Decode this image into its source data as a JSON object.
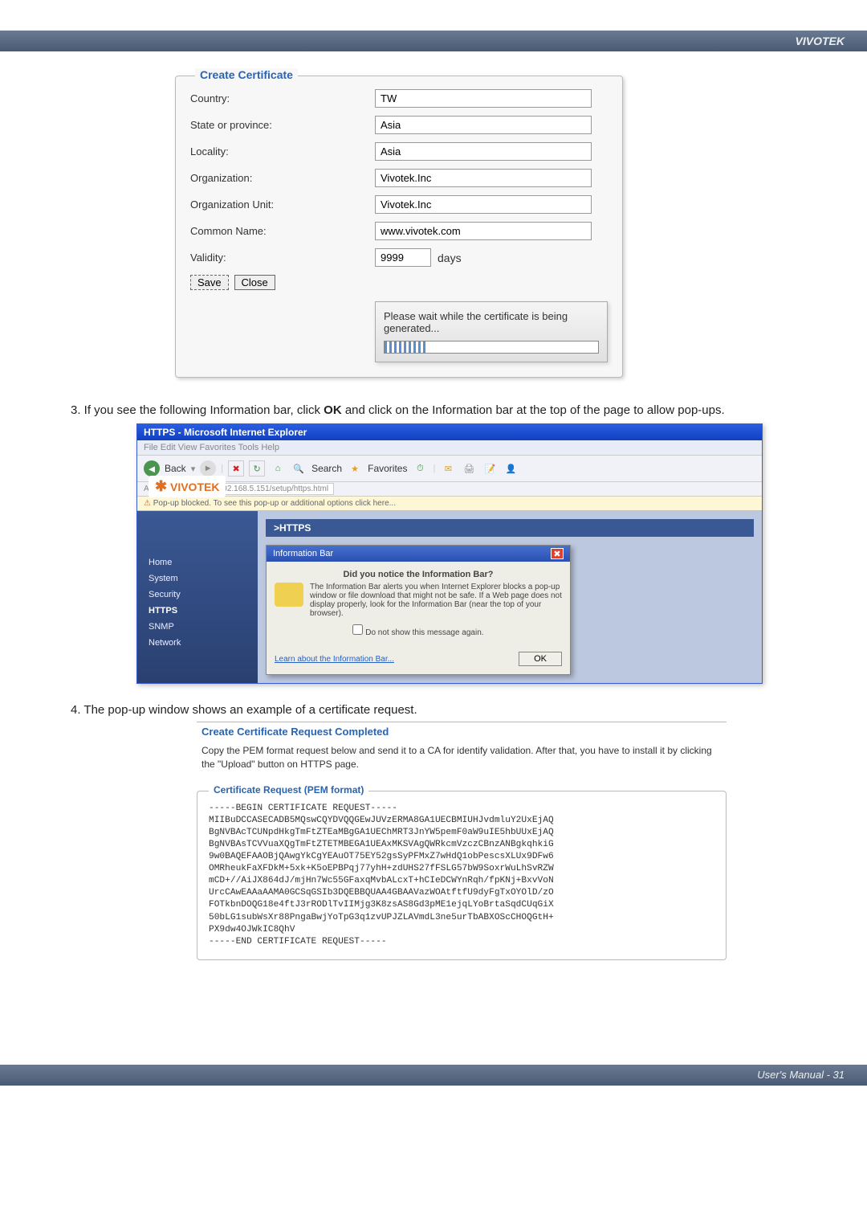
{
  "brand": "VIVOTEK",
  "cert_form": {
    "legend": "Create Certificate",
    "rows": {
      "country": {
        "label": "Country:",
        "value": "TW"
      },
      "state": {
        "label": "State or province:",
        "value": "Asia"
      },
      "locality": {
        "label": "Locality:",
        "value": "Asia"
      },
      "org": {
        "label": "Organization:",
        "value": "Vivotek.Inc"
      },
      "org_unit": {
        "label": "Organization Unit:",
        "value": "Vivotek.Inc"
      },
      "cn": {
        "label": "Common Name:",
        "value": "www.vivotek.com"
      },
      "validity": {
        "label": "Validity:",
        "value": "9999",
        "unit": "days"
      }
    },
    "buttons": {
      "save": "Save",
      "close": "Close"
    },
    "generating": "Please wait while the certificate is being generated..."
  },
  "step3": "3. If you see the following Information bar, click OK and click on the Information bar at the top of the page to allow pop-ups.",
  "ie": {
    "title": "HTTPS - Microsoft Internet Explorer",
    "menubar": "File   Edit   View   Favorites   Tools   Help",
    "toolbar": {
      "back": "Back",
      "search": "Search",
      "favorites": "Favorites"
    },
    "address_label": "Address",
    "address": "http://192.168.5.151/setup/https.html",
    "infobar": "Pop-up blocked. To see this pop-up or additional options click here...",
    "logo": "VIVOTEK",
    "https_header": ">HTTPS",
    "sidebar": [
      "Home",
      "System",
      "Security",
      "HTTPS",
      "SNMP",
      "Network"
    ],
    "dialog": {
      "title": "Information Bar",
      "notice_h": "Did you notice the Information Bar?",
      "notice_body": "The Information Bar alerts you when Internet Explorer blocks a pop-up window or file download that might not be safe. If a Web page does not display properly, look for the Information Bar (near the top of your browser).",
      "check": "Do not show this message again.",
      "link": "Learn about the Information Bar...",
      "ok": "OK"
    }
  },
  "step4": "4. The pop-up window shows an example of a certificate request.",
  "req": {
    "title": "Create Certificate Request Completed",
    "desc": "Copy the PEM format request below and send it to a CA for identify validation. After that, you have to install it by clicking the \"Upload\" button on HTTPS page.",
    "legend": "Certificate Request (PEM format)",
    "pem": "-----BEGIN CERTIFICATE REQUEST-----\nMIIBuDCCASECADB5MQswCQYDVQQGEwJUVzERMA8GA1UECBMIUHJvdmluY2UxEjAQ\nBgNVBAcTCUNpdHkgTmFtZTEaMBgGA1UEChMRT3JnYW5pemF0aW9uIE5hbUUxEjAQ\nBgNVBAsTCVVuaXQgTmFtZTETMBEGA1UEAxMKSVAgQWRkcmVzczCBnzANBgkqhkiG\n9w0BAQEFAAOBjQAwgYkCgYEAuOT75EY52gsSyPFMxZ7wHdQ1obPescsXLUx9DFw6\nOMRheukFaXFDkM+5xk+K5oEPBPqj77yhH+zdUHS27fFSLG57bW9SoxrWuLhSvRZW\nmCD+//AiJX864dJ/mjHn7Wc55GFaxqMvbALcxT+hCIeDCWYnRqh/fpKNj+BxvVoN\nUrcCAwEAAaAAMA0GCSqGSIb3DQEBBQUAA4GBAAVazWOAtftfU9dyFgTxOYOlD/zO\nFOTkbnDOQG18e4ftJ3rRODlTvIIMjg3K8zsAS8Gd3pME1ejqLYoBrtaSqdCUqGiX\n50bLG1subWsXr88PngaBwjYoTpG3q1zvUPJZLAVmdL3ne5urTbABXOScCHOQGtH+\nPX9dw4OJWkIC8QhV\n-----END CERTIFICATE REQUEST-----"
  },
  "footer": "User's Manual - 31"
}
